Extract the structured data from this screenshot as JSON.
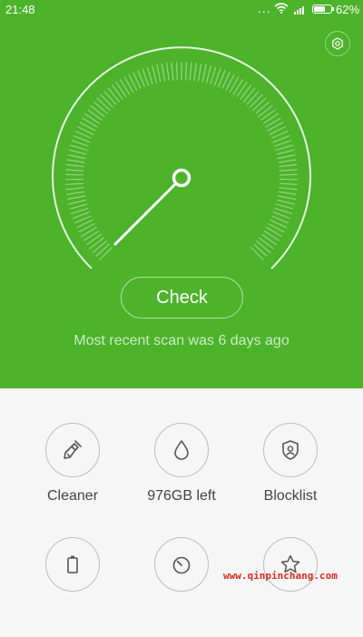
{
  "status_bar": {
    "time": "21:48",
    "dots": "...",
    "battery_percent": "62%",
    "battery_level": 0.62
  },
  "header": {
    "settings_icon": "gear-icon"
  },
  "gauge": {
    "needle_icon": "speed-needle"
  },
  "main": {
    "check_label": "Check",
    "scan_status": "Most recent scan was 6 days ago"
  },
  "tools": [
    {
      "label": "Cleaner",
      "icon": "broom-icon"
    },
    {
      "label": "976GB left",
      "icon": "water-drop-icon"
    },
    {
      "label": "Blocklist",
      "icon": "shield-user-icon"
    },
    {
      "label": "",
      "icon": "battery-icon"
    },
    {
      "label": "",
      "icon": "speedometer-icon"
    },
    {
      "label": "",
      "icon": "star-icon"
    }
  ],
  "watermark": "www.qinpinchang.com",
  "colors": {
    "accent": "#4cb32b",
    "background": "#f6f6f6",
    "icon_stroke": "#555555"
  }
}
